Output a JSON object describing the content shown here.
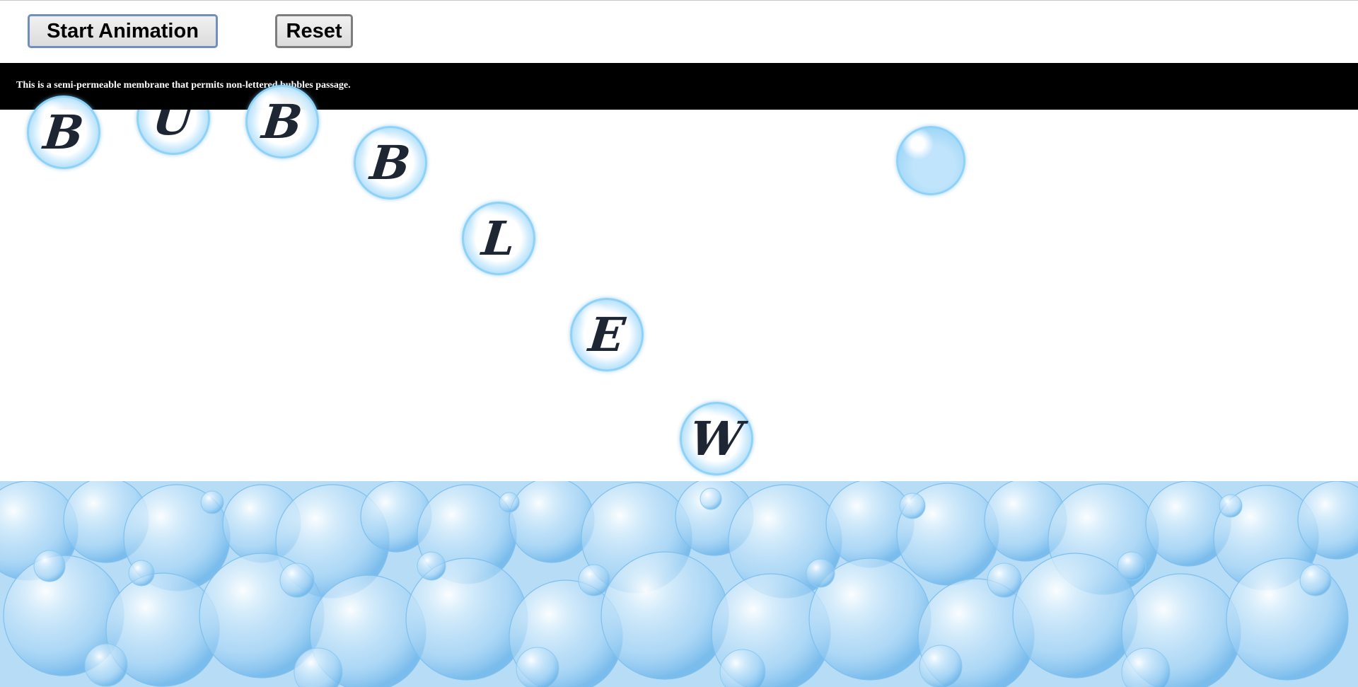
{
  "controls": {
    "start_label": "Start Animation",
    "reset_label": "Reset"
  },
  "membrane": {
    "text": "This is a semi-permeable membrane that permits non-lettered bubbles passage."
  },
  "bubbles": [
    {
      "letter": "B"
    },
    {
      "letter": "U"
    },
    {
      "letter": "B"
    },
    {
      "letter": "B"
    },
    {
      "letter": "L"
    },
    {
      "letter": "E"
    },
    {
      "letter": "W"
    },
    {
      "letter": ""
    }
  ],
  "colors": {
    "membrane": "#000000",
    "bubble_rim": "#8fd2f7",
    "letter": "#1f2633",
    "foam": "#a9d4f4"
  }
}
